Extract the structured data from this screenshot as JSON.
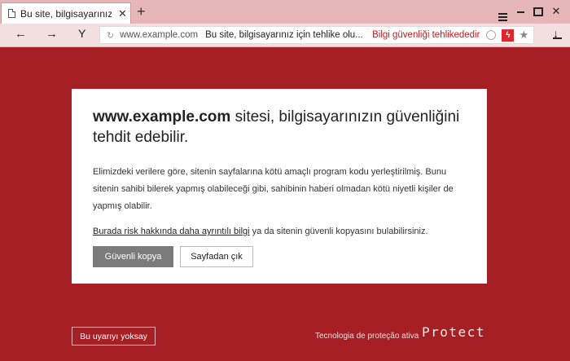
{
  "tab": {
    "title": "Bu site, bilgisayarınız için",
    "close": "✕"
  },
  "new_tab": "+",
  "window_controls": {
    "close": "✕"
  },
  "nav": {
    "back": "←",
    "forward": "→",
    "y_button": "Y"
  },
  "address": {
    "reload": "↻",
    "domain": "www.example.com",
    "title": "Bu site, bilgisayarınız için tehlike olu...",
    "warning": "Bilgi güvenliği tehlikededir",
    "badge": "ϟ",
    "star": "★"
  },
  "download": "↓",
  "card": {
    "headline_site": "www.example.com",
    "headline_rest": " sitesi, bilgisayarınızın güvenliğini tehdit edebilir.",
    "description": "Elimizdeki verilere göre, sitenin sayfalarına kötü amaçlı program kodu yerleştirilmiş. Bunu sitenin sahibi bilerek yapmış olabileceği gibi, sahibinin haberi olmadan kötü niyetli kişiler de yapmış olabilir.",
    "info_link": "Burada risk hakkında daha ayrıntılı bilgi",
    "info_rest": " ya da sitenin güvenli kopyasını bulabilirsiniz.",
    "safe_copy_button": "Güvenli kopya",
    "leave_button": "Sayfadan çık"
  },
  "footer": {
    "ignore_button": "Bu uyarıyı yoksay",
    "tech_text": "Tecnologia de proteção ativa",
    "brand": "Protect"
  },
  "colors": {
    "background": "#a51f24",
    "warning_text": "#c9171e",
    "primary_button": "#7b7b7b"
  }
}
